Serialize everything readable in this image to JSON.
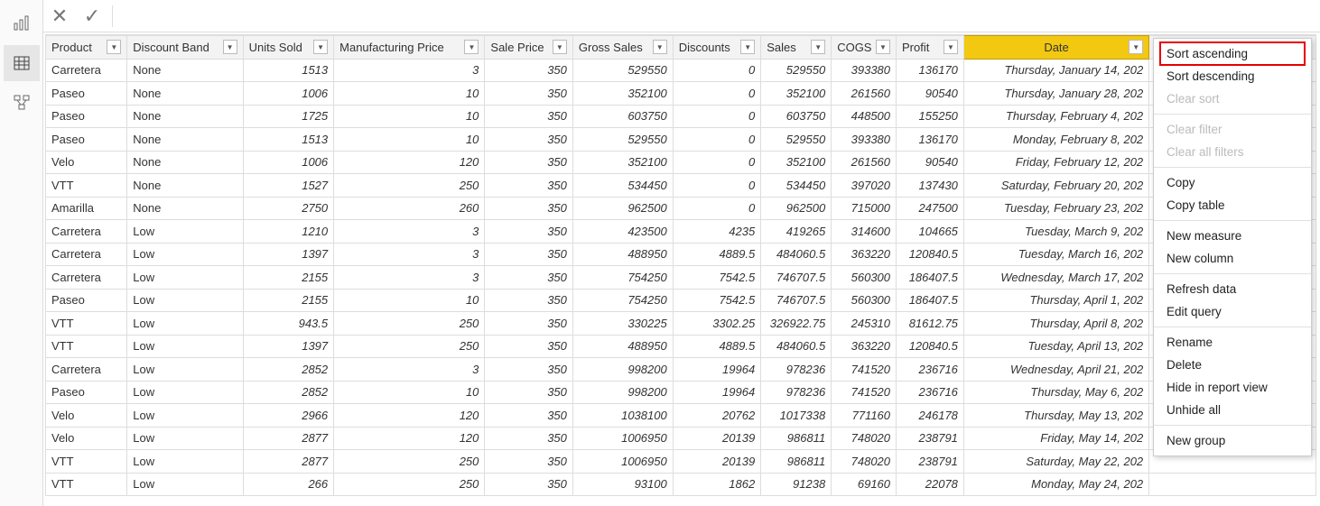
{
  "rail": {
    "report_tooltip": "Report view",
    "data_tooltip": "Data view",
    "model_tooltip": "Model view"
  },
  "columns": [
    {
      "key": "product",
      "label": "Product",
      "align": "left"
    },
    {
      "key": "discband",
      "label": "Discount Band",
      "align": "left"
    },
    {
      "key": "units",
      "label": "Units Sold",
      "align": "num"
    },
    {
      "key": "mfg",
      "label": "Manufacturing Price",
      "align": "num"
    },
    {
      "key": "sale",
      "label": "Sale Price",
      "align": "num"
    },
    {
      "key": "gross",
      "label": "Gross Sales",
      "align": "num"
    },
    {
      "key": "disc",
      "label": "Discounts",
      "align": "num"
    },
    {
      "key": "sales",
      "label": "Sales",
      "align": "num"
    },
    {
      "key": "cogs",
      "label": "COGS",
      "align": "num"
    },
    {
      "key": "profit",
      "label": "Profit",
      "align": "num"
    },
    {
      "key": "date",
      "label": "Date",
      "align": "date",
      "selected": true
    }
  ],
  "rows": [
    {
      "product": "Carretera",
      "discband": "None",
      "units": "1513",
      "mfg": "3",
      "sale": "350",
      "gross": "529550",
      "disc": "0",
      "sales": "529550",
      "cogs": "393380",
      "profit": "136170",
      "date": "Thursday, January 14, 202"
    },
    {
      "product": "Paseo",
      "discband": "None",
      "units": "1006",
      "mfg": "10",
      "sale": "350",
      "gross": "352100",
      "disc": "0",
      "sales": "352100",
      "cogs": "261560",
      "profit": "90540",
      "date": "Thursday, January 28, 202"
    },
    {
      "product": "Paseo",
      "discband": "None",
      "units": "1725",
      "mfg": "10",
      "sale": "350",
      "gross": "603750",
      "disc": "0",
      "sales": "603750",
      "cogs": "448500",
      "profit": "155250",
      "date": "Thursday, February 4, 202"
    },
    {
      "product": "Paseo",
      "discband": "None",
      "units": "1513",
      "mfg": "10",
      "sale": "350",
      "gross": "529550",
      "disc": "0",
      "sales": "529550",
      "cogs": "393380",
      "profit": "136170",
      "date": "Monday, February 8, 202"
    },
    {
      "product": "Velo",
      "discband": "None",
      "units": "1006",
      "mfg": "120",
      "sale": "350",
      "gross": "352100",
      "disc": "0",
      "sales": "352100",
      "cogs": "261560",
      "profit": "90540",
      "date": "Friday, February 12, 202"
    },
    {
      "product": "VTT",
      "discband": "None",
      "units": "1527",
      "mfg": "250",
      "sale": "350",
      "gross": "534450",
      "disc": "0",
      "sales": "534450",
      "cogs": "397020",
      "profit": "137430",
      "date": "Saturday, February 20, 202"
    },
    {
      "product": "Amarilla",
      "discband": "None",
      "units": "2750",
      "mfg": "260",
      "sale": "350",
      "gross": "962500",
      "disc": "0",
      "sales": "962500",
      "cogs": "715000",
      "profit": "247500",
      "date": "Tuesday, February 23, 202"
    },
    {
      "product": "Carretera",
      "discband": "Low",
      "units": "1210",
      "mfg": "3",
      "sale": "350",
      "gross": "423500",
      "disc": "4235",
      "sales": "419265",
      "cogs": "314600",
      "profit": "104665",
      "date": "Tuesday, March 9, 202"
    },
    {
      "product": "Carretera",
      "discband": "Low",
      "units": "1397",
      "mfg": "3",
      "sale": "350",
      "gross": "488950",
      "disc": "4889.5",
      "sales": "484060.5",
      "cogs": "363220",
      "profit": "120840.5",
      "date": "Tuesday, March 16, 202"
    },
    {
      "product": "Carretera",
      "discband": "Low",
      "units": "2155",
      "mfg": "3",
      "sale": "350",
      "gross": "754250",
      "disc": "7542.5",
      "sales": "746707.5",
      "cogs": "560300",
      "profit": "186407.5",
      "date": "Wednesday, March 17, 202"
    },
    {
      "product": "Paseo",
      "discband": "Low",
      "units": "2155",
      "mfg": "10",
      "sale": "350",
      "gross": "754250",
      "disc": "7542.5",
      "sales": "746707.5",
      "cogs": "560300",
      "profit": "186407.5",
      "date": "Thursday, April 1, 202"
    },
    {
      "product": "VTT",
      "discband": "Low",
      "units": "943.5",
      "mfg": "250",
      "sale": "350",
      "gross": "330225",
      "disc": "3302.25",
      "sales": "326922.75",
      "cogs": "245310",
      "profit": "81612.75",
      "date": "Thursday, April 8, 202"
    },
    {
      "product": "VTT",
      "discband": "Low",
      "units": "1397",
      "mfg": "250",
      "sale": "350",
      "gross": "488950",
      "disc": "4889.5",
      "sales": "484060.5",
      "cogs": "363220",
      "profit": "120840.5",
      "date": "Tuesday, April 13, 202"
    },
    {
      "product": "Carretera",
      "discband": "Low",
      "units": "2852",
      "mfg": "3",
      "sale": "350",
      "gross": "998200",
      "disc": "19964",
      "sales": "978236",
      "cogs": "741520",
      "profit": "236716",
      "date": "Wednesday, April 21, 202"
    },
    {
      "product": "Paseo",
      "discband": "Low",
      "units": "2852",
      "mfg": "10",
      "sale": "350",
      "gross": "998200",
      "disc": "19964",
      "sales": "978236",
      "cogs": "741520",
      "profit": "236716",
      "date": "Thursday, May 6, 202"
    },
    {
      "product": "Velo",
      "discband": "Low",
      "units": "2966",
      "mfg": "120",
      "sale": "350",
      "gross": "1038100",
      "disc": "20762",
      "sales": "1017338",
      "cogs": "771160",
      "profit": "246178",
      "date": "Thursday, May 13, 202"
    },
    {
      "product": "Velo",
      "discband": "Low",
      "units": "2877",
      "mfg": "120",
      "sale": "350",
      "gross": "1006950",
      "disc": "20139",
      "sales": "986811",
      "cogs": "748020",
      "profit": "238791",
      "date": "Friday, May 14, 202"
    },
    {
      "product": "VTT",
      "discband": "Low",
      "units": "2877",
      "mfg": "250",
      "sale": "350",
      "gross": "1006950",
      "disc": "20139",
      "sales": "986811",
      "cogs": "748020",
      "profit": "238791",
      "date": "Saturday, May 22, 202"
    },
    {
      "product": "VTT",
      "discband": "Low",
      "units": "266",
      "mfg": "250",
      "sale": "350",
      "gross": "93100",
      "disc": "1862",
      "sales": "91238",
      "cogs": "69160",
      "profit": "22078",
      "date": "Monday, May 24, 202"
    }
  ],
  "ctx": {
    "sort_asc": "Sort ascending",
    "sort_desc": "Sort descending",
    "clear_sort": "Clear sort",
    "clear_filter": "Clear filter",
    "clear_all_filters": "Clear all filters",
    "copy": "Copy",
    "copy_table": "Copy table",
    "new_measure": "New measure",
    "new_column": "New column",
    "refresh_data": "Refresh data",
    "edit_query": "Edit query",
    "rename": "Rename",
    "delete": "Delete",
    "hide": "Hide in report view",
    "unhide": "Unhide all",
    "new_group": "New group"
  }
}
